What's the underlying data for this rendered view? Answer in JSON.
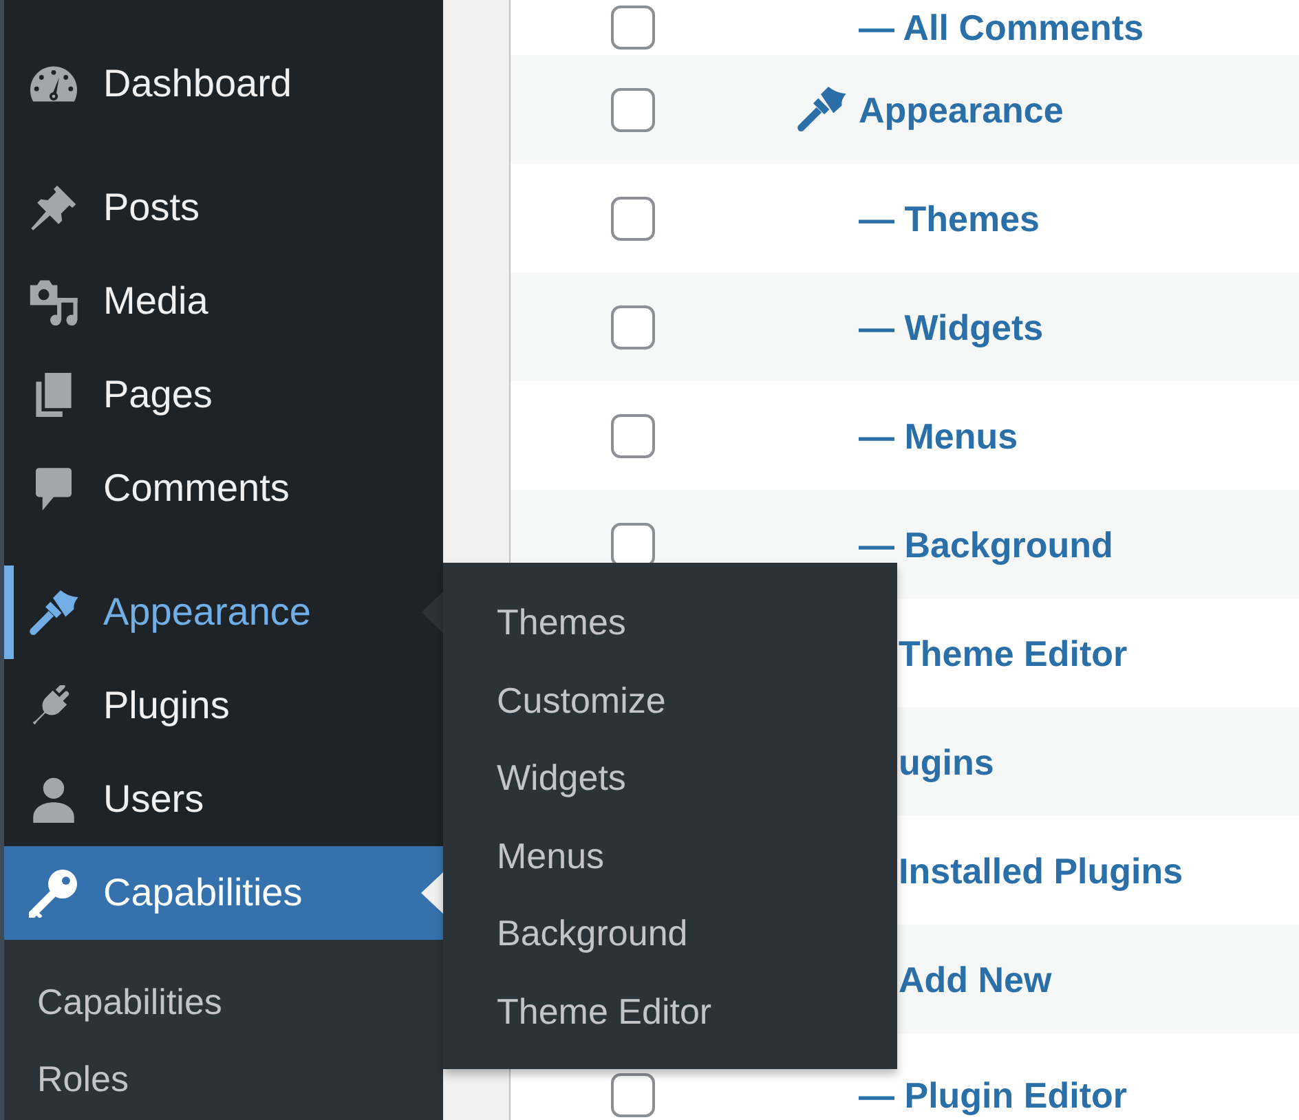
{
  "sidebar": {
    "groups": [
      {
        "items": [
          {
            "label": "Dashboard",
            "selected": false,
            "hovered": false
          }
        ]
      },
      {
        "items": [
          {
            "label": "Posts",
            "selected": false,
            "hovered": false
          },
          {
            "label": "Media",
            "selected": false,
            "hovered": false
          },
          {
            "label": "Pages",
            "selected": false,
            "hovered": false
          },
          {
            "label": "Comments",
            "selected": false,
            "hovered": false
          }
        ]
      },
      {
        "items": [
          {
            "label": "Appearance",
            "selected": false,
            "hovered": true,
            "submenu": [
              {
                "label": "Themes",
                "selected": false
              },
              {
                "label": "Customize",
                "selected": false
              },
              {
                "label": "Widgets",
                "selected": false
              },
              {
                "label": "Menus",
                "selected": false
              },
              {
                "label": "Background",
                "selected": false
              },
              {
                "label": "Theme Editor",
                "selected": false
              }
            ]
          },
          {
            "label": "Plugins",
            "selected": false,
            "hovered": false
          },
          {
            "label": "Users",
            "selected": false,
            "hovered": false
          },
          {
            "label": "Capabilities",
            "selected": true,
            "hovered": false,
            "submenu": [
              {
                "label": "Capabilities",
                "selected": false
              },
              {
                "label": "Roles",
                "selected": false
              }
            ]
          }
        ]
      }
    ]
  },
  "table": {
    "rows": [
      {
        "kind": "submenu",
        "label": "— All Comments",
        "covered": false,
        "checked": false
      },
      {
        "kind": "menu",
        "label": "Appearance",
        "covered": false,
        "checked": false
      },
      {
        "kind": "submenu",
        "label": "— Themes",
        "covered": false,
        "checked": false
      },
      {
        "kind": "submenu",
        "label": "— Widgets",
        "covered": false,
        "checked": false
      },
      {
        "kind": "submenu",
        "label": "— Menus",
        "covered": false,
        "checked": false
      },
      {
        "kind": "submenu",
        "label": "— Background",
        "covered": false,
        "checked": false
      },
      {
        "label": "Theme Editor",
        "covered": true
      },
      {
        "label": "ugins",
        "covered": true
      },
      {
        "label": "Installed Plugins",
        "covered": true
      },
      {
        "label": "Add New",
        "covered": true
      },
      {
        "kind": "submenu",
        "label": "— Plugin Editor",
        "covered": false,
        "checked": false
      }
    ]
  }
}
